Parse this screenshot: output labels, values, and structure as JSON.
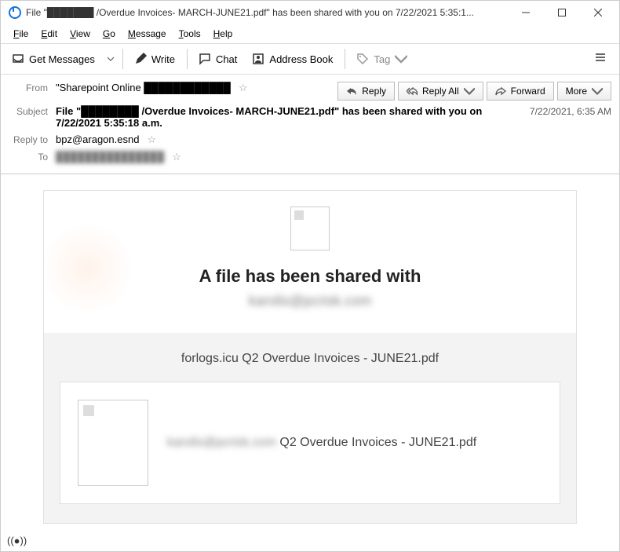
{
  "titlebar": {
    "title": "File \"███████ /Overdue Invoices- MARCH-JUNE21.pdf\" has been shared with you on 7/22/2021 5:35:1..."
  },
  "menubar": {
    "file": "File",
    "edit": "Edit",
    "view": "View",
    "go": "Go",
    "message": "Message",
    "tools": "Tools",
    "help": "Help"
  },
  "toolbar": {
    "get_messages": "Get Messages",
    "write": "Write",
    "chat": "Chat",
    "address_book": "Address Book",
    "tag": "Tag"
  },
  "header": {
    "from_label": "From",
    "from_value": "\"Sharepoint Online ████████████",
    "subject_label": "Subject",
    "subject_value": "File \"████████ /Overdue Invoices- MARCH-JUNE21.pdf\" has been shared with you on 7/22/2021 5:35:18 a.m.",
    "reply_to_label": "Reply to",
    "reply_to_value": "bpz@aragon.esnd",
    "to_label": "To",
    "to_value": "███████████████",
    "timestamp": "7/22/2021, 6:35 AM",
    "actions": {
      "reply": "Reply",
      "reply_all": "Reply All",
      "forward": "Forward",
      "more": "More"
    }
  },
  "body": {
    "shared_title": "A file has been shared with",
    "shared_email": "karolis@pcrisk.com",
    "file_center": "forlogs.icu Q2 Overdue Invoices - JUNE21.pdf",
    "file_desc_blur": "karolis@pcrisk.com",
    "file_desc_rest": " Q2 Overdue Invoices - JUNE21.pdf"
  }
}
